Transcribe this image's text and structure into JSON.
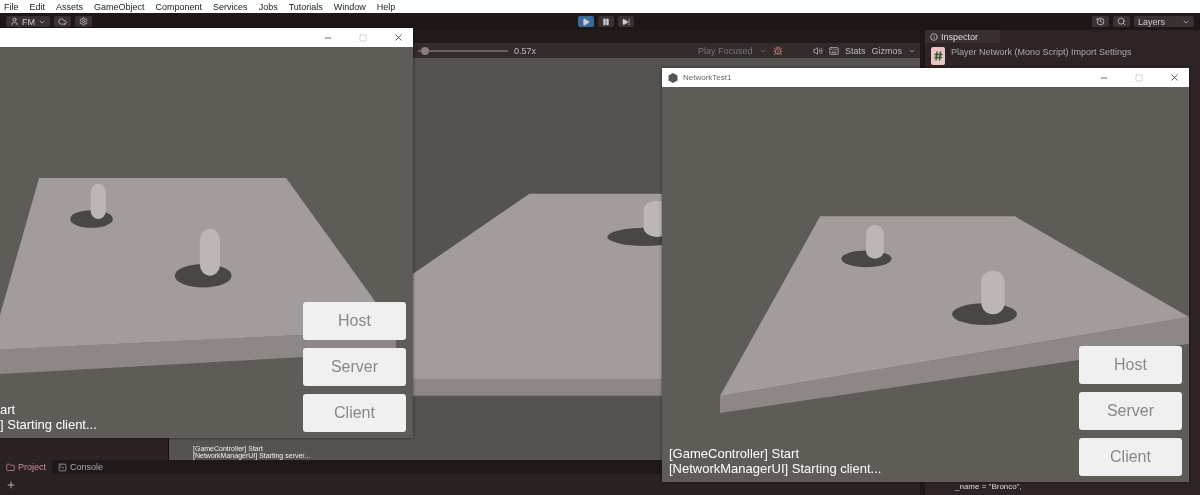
{
  "menu_bar": [
    "File",
    "Edit",
    "Assets",
    "GameObject",
    "Component",
    "Services",
    "Jobs",
    "Tutorials",
    "Window",
    "Help"
  ],
  "toolbar": {
    "account": "FM",
    "play_controls": [
      {
        "kind": "play",
        "selected": true
      },
      {
        "kind": "pause",
        "selected": false
      },
      {
        "kind": "step",
        "selected": false
      }
    ],
    "layers": "Layers"
  },
  "game_view": {
    "scale": "0.57x",
    "level": 0.08,
    "play_mode": "Play Focused",
    "stats": "Stats",
    "gizmos": "Gizmos",
    "log": [
      "[GameController] Start",
      "[NetworkManagerUI] Starting server..."
    ]
  },
  "inspector": {
    "tab": "Inspector",
    "title": "Player Network (Mono Script) Import Settings",
    "code_line": "_name = \"Bronco\","
  },
  "bottom_tabs": [
    {
      "label": "Project",
      "selected": true
    },
    {
      "label": "Console",
      "selected": false
    }
  ],
  "windows": [
    {
      "buttons": [
        "Host",
        "Server",
        "Client"
      ],
      "log": [
        "art",
        "] Starting client..."
      ]
    },
    {
      "title": "NetworkTest1",
      "buttons": [
        "Host",
        "Server",
        "Client"
      ],
      "log": [
        "[GameController] Start",
        "[NetworkManagerUI] Starting client..."
      ]
    }
  ]
}
